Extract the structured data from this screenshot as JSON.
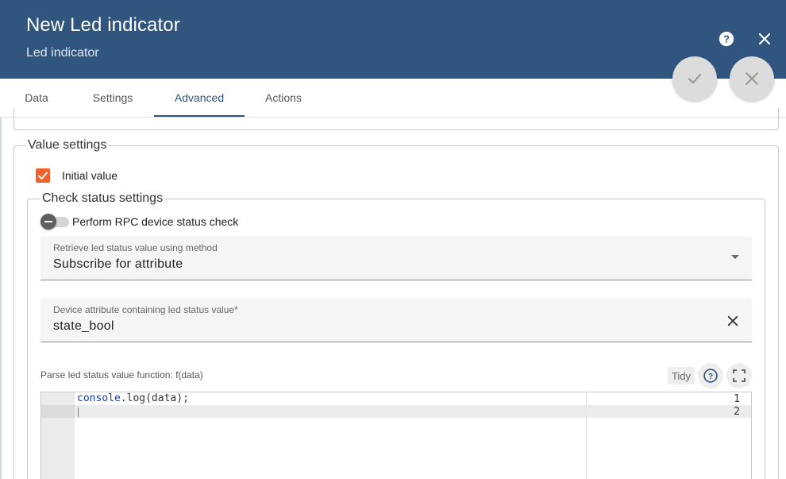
{
  "header": {
    "title": "New Led indicator",
    "subtitle": "Led indicator",
    "help_icon": "help-circle-icon",
    "close_icon": "close-icon",
    "bg_color": "#305680"
  },
  "fabs": {
    "apply_icon": "check-icon",
    "cancel_icon": "close-icon"
  },
  "tabs": [
    {
      "label": "Data"
    },
    {
      "label": "Settings"
    },
    {
      "label": "Advanced",
      "active": true
    },
    {
      "label": "Actions"
    }
  ],
  "value_settings": {
    "legend": "Value settings",
    "initial_value": {
      "label": "Initial value",
      "checked": true,
      "color": "#f0622d"
    },
    "check_status": {
      "legend": "Check status settings",
      "rpc_toggle": {
        "label": "Perform RPC device status check",
        "enabled": false
      },
      "method_field": {
        "label": "Retrieve led status value using method",
        "value": "Subscribe for attribute"
      },
      "attribute_field": {
        "label": "Device attribute containing led status value*",
        "value": "state_bool"
      },
      "function": {
        "label": "Parse led status value function: f(data)",
        "tidy_label": "Tidy",
        "line_numbers": [
          "1",
          "2"
        ],
        "code_object": "console",
        "code_rest": ".log(data);"
      }
    }
  }
}
